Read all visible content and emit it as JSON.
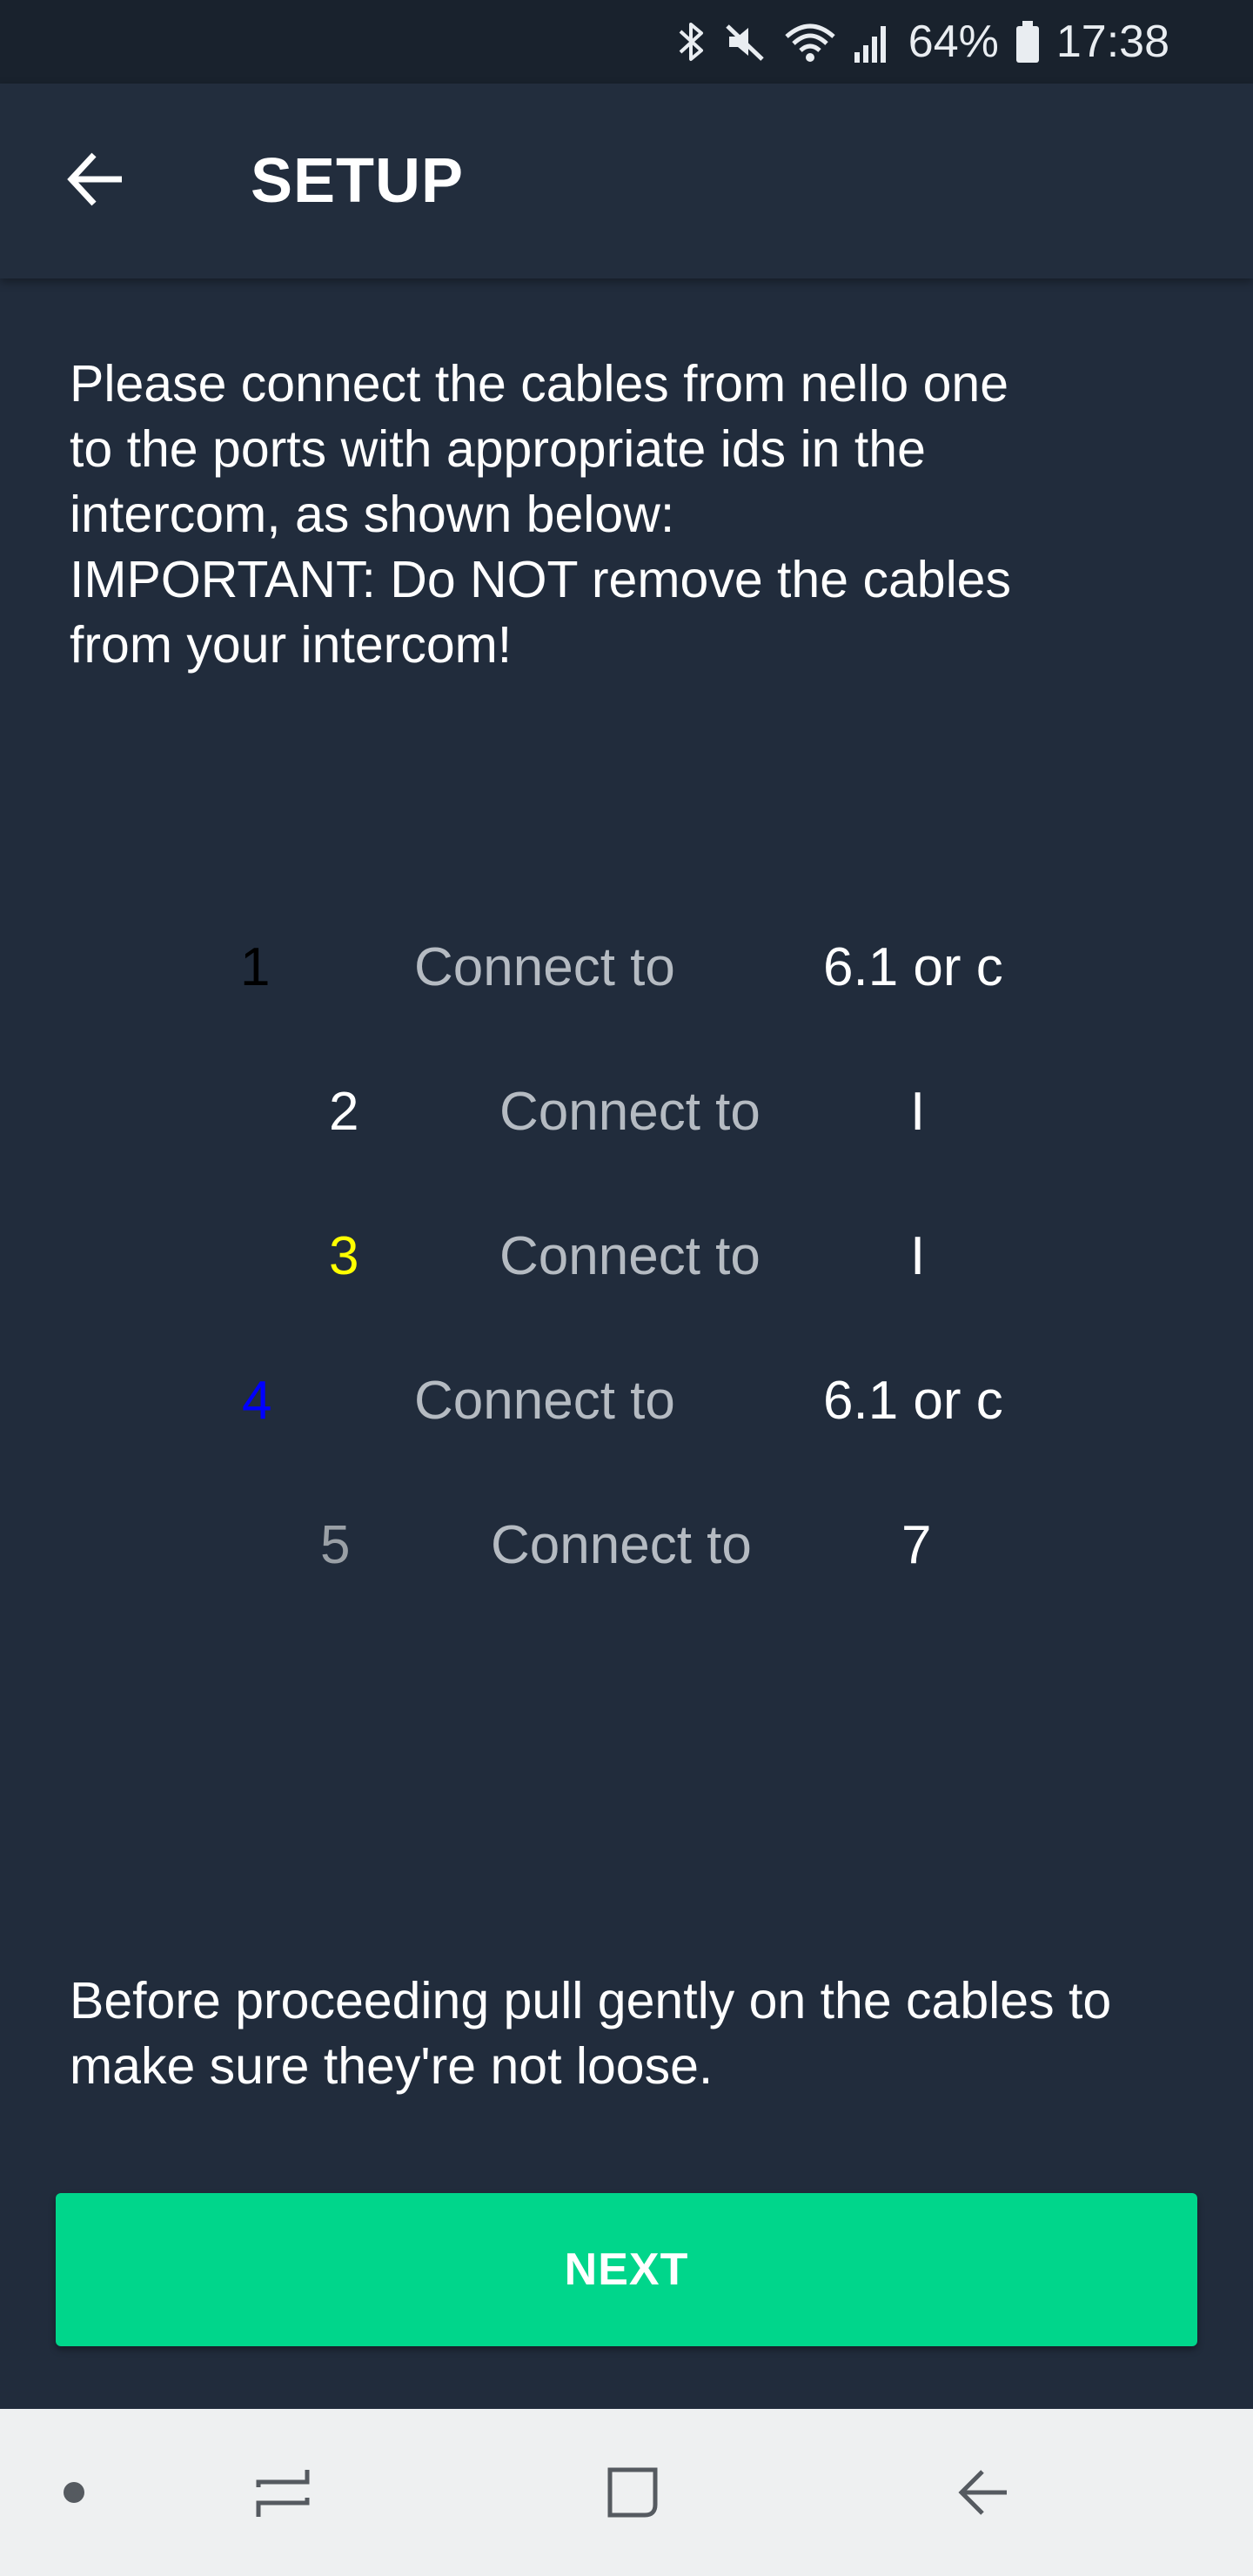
{
  "status_bar": {
    "battery": "64%",
    "time": "17:38",
    "icons": [
      "bluetooth-icon",
      "mute-icon",
      "wifi-icon",
      "signal-icon",
      "battery-icon"
    ]
  },
  "header": {
    "back_icon": "arrow-left-icon",
    "title": "SETUP"
  },
  "instructions": "Please connect the cables from nello one\nto the ports with appropriate ids in the\nintercom, as shown below:\n IMPORTANT: Do NOT remove the cables\nfrom your intercom!",
  "connections": [
    {
      "id": "1",
      "label": "Connect to",
      "target": "6.1 or c",
      "id_color": "#000000"
    },
    {
      "id": "2",
      "label": "Connect to",
      "target": "I",
      "id_color": "#ffffff"
    },
    {
      "id": "3",
      "label": "Connect to",
      "target": "I",
      "id_color": "#ffff00"
    },
    {
      "id": "4",
      "label": "Connect to",
      "target": "6.1 or c",
      "id_color": "#0000ff"
    },
    {
      "id": "5",
      "label": "Connect to",
      "target": "7",
      "id_color": "#9aa0a6"
    }
  ],
  "footer_note": "Before proceeding pull gently on the cables to make sure they're not loose.",
  "next_button": {
    "label": "NEXT",
    "color": "#00d68b"
  },
  "nav_bar": {
    "icons": [
      "dot-icon",
      "recents-icon",
      "home-icon",
      "back-icon"
    ]
  }
}
